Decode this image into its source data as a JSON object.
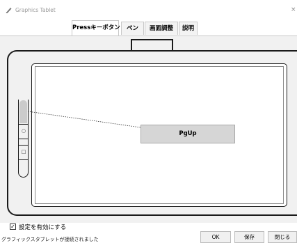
{
  "window": {
    "title": "Graphics Tablet",
    "icon": "pen-tool-icon",
    "close_glyph": "×"
  },
  "tabs": [
    {
      "label": "Pressキーボタン",
      "active": true
    },
    {
      "label": "ペン",
      "active": false
    },
    {
      "label": "画面調整",
      "active": false
    },
    {
      "label": "説明",
      "active": false
    }
  ],
  "tablet": {
    "mapped_key": "PgUp",
    "side_buttons": [
      "circle-button-icon",
      "square-button-icon"
    ],
    "button_glyphs": [
      "○",
      "□"
    ]
  },
  "settings": {
    "enable_label": "設定を有効にする",
    "enable_checked": true,
    "check_glyph": "✓"
  },
  "status": {
    "message": "グラフィックスタブレットが接続されました"
  },
  "footer": {
    "ok_label": "OK",
    "save_label": "保存",
    "close_label": "閉じる"
  }
}
